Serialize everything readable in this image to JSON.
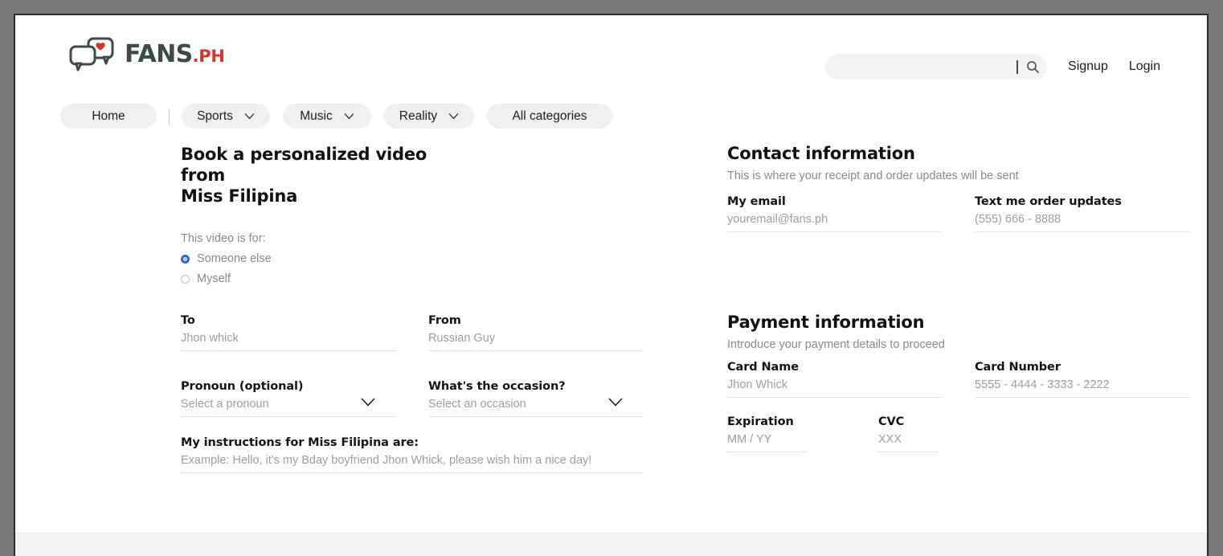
{
  "brand": {
    "name": "FANS",
    "suffix": ".PH",
    "logo_icon": "chat-bubbles-heart-icon",
    "text_color": "#3c4a49",
    "accent_color": "#d5352b"
  },
  "header": {
    "search": {
      "value": "",
      "placeholder": "",
      "icon": "search-icon"
    },
    "signup_label": "Signup",
    "login_label": "Login"
  },
  "nav": {
    "items": [
      {
        "label": "Home",
        "has_chevron": false
      },
      {
        "label": "Sports",
        "has_chevron": true
      },
      {
        "label": "Music",
        "has_chevron": true
      },
      {
        "label": "Reality",
        "has_chevron": true
      },
      {
        "label": "All categories",
        "has_chevron": false
      }
    ]
  },
  "booking": {
    "title_line1": "Book a personalized video from",
    "title_line2": "Miss Filipina",
    "video_for_label": "This video is for:",
    "radio_options": [
      {
        "label": "Someone else",
        "selected": true
      },
      {
        "label": "Myself",
        "selected": false
      }
    ],
    "selected_radio_color": "#2b6cc4",
    "fields": {
      "to": {
        "label": "To",
        "value": "",
        "placeholder": "Jhon whick"
      },
      "from": {
        "label": "From",
        "value": "",
        "placeholder": "Russian Guy"
      },
      "pronoun": {
        "label": "Pronoun (optional)",
        "value": "",
        "placeholder": "Select a pronoun",
        "icon": "chevron-down-icon"
      },
      "occasion": {
        "label": "What's the occasion?",
        "value": "",
        "placeholder": "Select an occasion",
        "icon": "chevron-down-icon"
      },
      "instructions": {
        "label": "My instructions for Miss Filipina are:",
        "value": "",
        "placeholder": "Example: Hello, it's my Bday boyfriend Jhon Whick, please wish him a nice day!"
      }
    }
  },
  "contact": {
    "title": "Contact information",
    "subtitle": "This is where your receipt and order updates will be sent",
    "fields": {
      "email": {
        "label": "My email",
        "value": "",
        "placeholder": "youremail@fans.ph"
      },
      "phone": {
        "label": "Text me order updates",
        "value": "",
        "placeholder": "(555) 666 - 8888"
      }
    }
  },
  "payment": {
    "title": "Payment information",
    "subtitle": "Introduce your payment details to proceed",
    "fields": {
      "card_name": {
        "label": "Card Name",
        "value": "",
        "placeholder": "Jhon Whick"
      },
      "card_number": {
        "label": "Card Number",
        "value": "",
        "placeholder": "5555 - 4444 - 3333 - 2222"
      },
      "expiration": {
        "label": "Expiration",
        "value": "",
        "placeholder": "MM / YY"
      },
      "cvc": {
        "label": "CVC",
        "value": "",
        "placeholder": "XXX"
      }
    }
  }
}
